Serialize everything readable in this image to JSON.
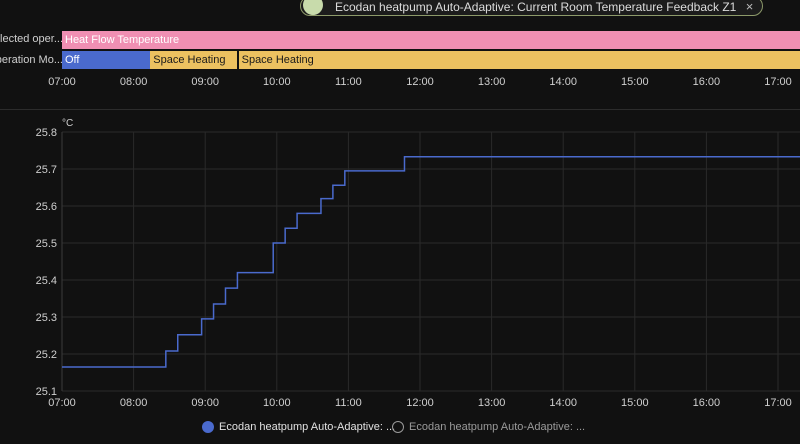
{
  "chip": {
    "label": "Ecodan heatpump Auto-Adaptive: Current Room Temperature Feedback Z1",
    "close": "×"
  },
  "timeline": {
    "rows": [
      {
        "label": "elected oper...",
        "segments": [
          {
            "label": "Heat Flow Temperature",
            "start": "07:00",
            "end": "17:20",
            "color": "#f08fb3"
          }
        ]
      },
      {
        "label": "peration Mo...",
        "segments": [
          {
            "label": "Off",
            "start": "07:00",
            "end": "08:14",
            "color": "#4a6acd"
          },
          {
            "label": "Space Heating",
            "start": "08:14",
            "end": "09:27",
            "color": "#ecc160"
          },
          {
            "label": "Space Heating",
            "start": "09:28",
            "end": "17:20",
            "color": "#ecc160"
          }
        ]
      }
    ],
    "ticks": [
      "07:00",
      "08:00",
      "09:00",
      "10:00",
      "11:00",
      "12:00",
      "13:00",
      "14:00",
      "15:00",
      "16:00",
      "17:00"
    ]
  },
  "chart_data": {
    "type": "line",
    "step": true,
    "ylabel": "°C",
    "ylim": [
      25.1,
      25.8
    ],
    "yticks": [
      "25.1",
      "25.2",
      "25.3",
      "25.4",
      "25.5",
      "25.6",
      "25.7",
      "25.8"
    ],
    "xticks": [
      "07:00",
      "08:00",
      "09:00",
      "10:00",
      "11:00",
      "12:00",
      "13:00",
      "14:00",
      "15:00",
      "16:00",
      "17:00"
    ],
    "xlim": [
      "07:00",
      "17:20"
    ],
    "grid": true,
    "series": [
      {
        "name": "Ecodan heatpump Auto-Adaptive: ...",
        "color": "#4a6acd",
        "points": [
          [
            "07:00",
            25.165
          ],
          [
            "08:27",
            25.208
          ],
          [
            "08:37",
            25.252
          ],
          [
            "08:57",
            25.295
          ],
          [
            "09:07",
            25.335
          ],
          [
            "09:17",
            25.378
          ],
          [
            "09:27",
            25.42
          ],
          [
            "09:57",
            25.5
          ],
          [
            "10:07",
            25.54
          ],
          [
            "10:17",
            25.58
          ],
          [
            "10:37",
            25.62
          ],
          [
            "10:47",
            25.656
          ],
          [
            "10:57",
            25.695
          ],
          [
            "11:47",
            25.733
          ],
          [
            "17:20",
            25.733
          ]
        ]
      }
    ]
  },
  "legend": [
    {
      "label": "Ecodan heatpump Auto-Adaptive: ...",
      "color": "#4a6acd",
      "active": true
    },
    {
      "label": "Ecodan heatpump Auto-Adaptive: ...",
      "active": false
    }
  ]
}
